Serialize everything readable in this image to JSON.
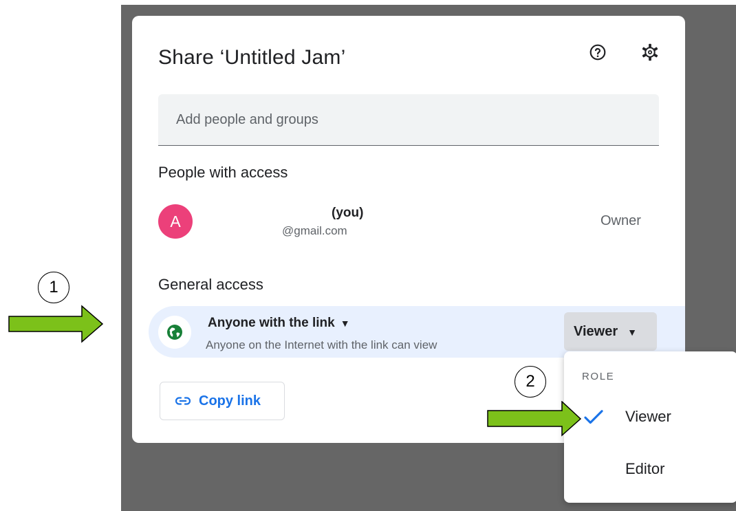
{
  "dialog": {
    "title": "Share ‘Untitled Jam’",
    "help_icon": "help-circle-icon",
    "settings_icon": "gear-icon"
  },
  "add_people": {
    "placeholder": "Add people and groups"
  },
  "people_with_access": {
    "heading": "People with access",
    "people": [
      {
        "avatar_letter": "A",
        "avatar_color": "#ec407a",
        "name_suffix": "(you)",
        "email": "@gmail.com",
        "role": "Owner"
      }
    ]
  },
  "general_access": {
    "heading": "General access",
    "icon": "globe-icon",
    "link_setting": "Anyone with the link",
    "description": "Anyone on the Internet with the link can view",
    "role": "Viewer"
  },
  "copy_link": {
    "icon": "link-icon",
    "label": "Copy link"
  },
  "role_menu": {
    "heading": "ROLE",
    "items": [
      {
        "label": "Viewer",
        "selected": true
      },
      {
        "label": "Editor",
        "selected": false
      }
    ]
  },
  "annotations": {
    "step1": "1",
    "step2": "2",
    "arrow_color": "#7cc11a"
  },
  "colors": {
    "accent": "#1a73e8",
    "backdrop": "#666666",
    "highlight_row": "#e8f0fe",
    "globe": "#188038"
  }
}
